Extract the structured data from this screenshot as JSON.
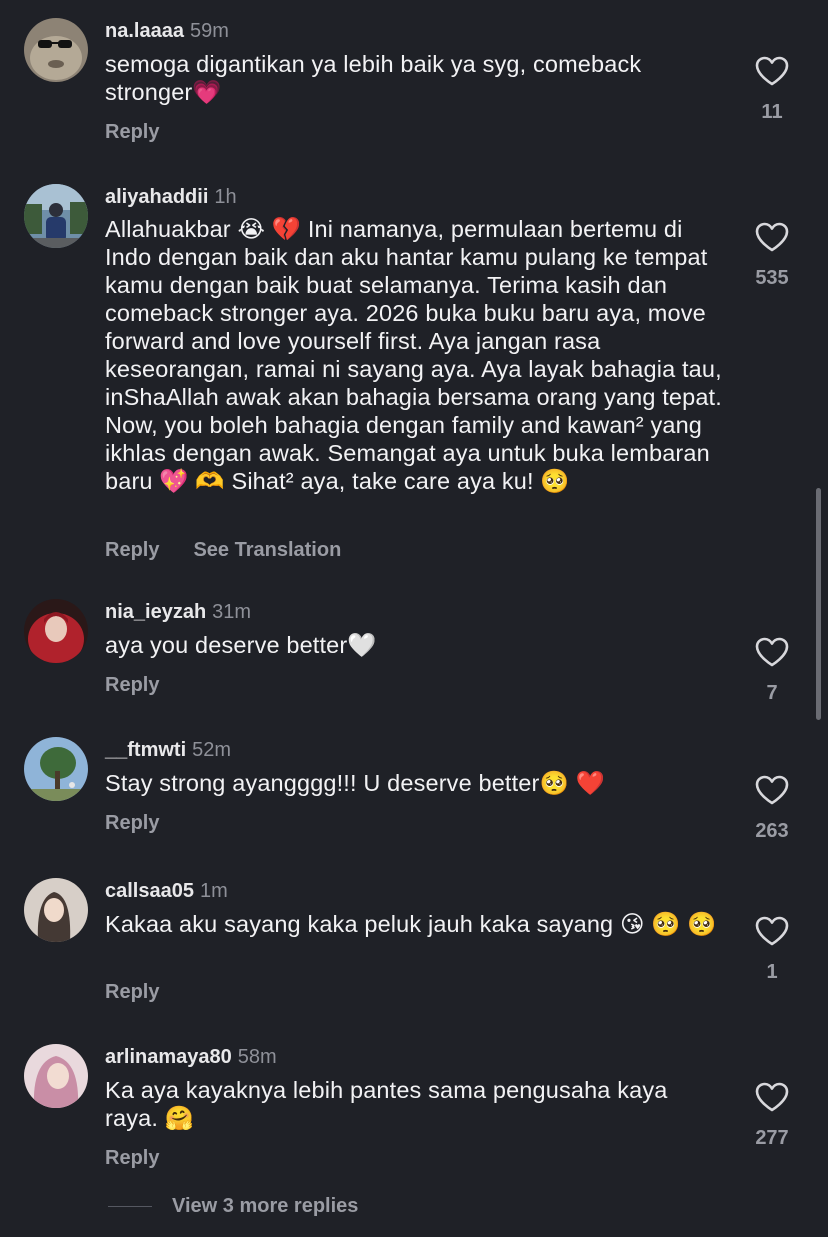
{
  "comments": [
    {
      "username": "na.laaaa",
      "time": "59m",
      "text": "semoga digantikan ya lebih baik ya syg, comeback stronger💗",
      "reply_label": "Reply",
      "likes": "11"
    },
    {
      "username": "aliyahaddii",
      "time": "1h",
      "text": "Allahuakbar 😭 💔  Ini namanya, permulaan bertemu di Indo dengan baik dan aku hantar kamu pulang ke tempat kamu dengan baik buat selamanya. Terima kasih dan comeback stronger aya. 2026 buka buku baru aya, move forward and love yourself first. Aya jangan rasa keseorangan, ramai ni sayang aya. Aya layak bahagia tau, inShaAllah awak akan bahagia bersama orang yang tepat. Now, you boleh bahagia dengan family and kawan² yang ikhlas dengan awak. Semangat aya untuk buka lembaran baru 💖 🫶 Sihat² aya, take care aya ku! 🥺",
      "reply_label": "Reply",
      "see_translation_label": "See Translation",
      "likes": "535"
    },
    {
      "username": "nia_ieyzah",
      "time": "31m",
      "text": "aya you deserve better🤍",
      "reply_label": "Reply",
      "likes": "7"
    },
    {
      "username": "__ftmwti",
      "time": "52m",
      "text": "Stay strong ayangggg!!! U deserve better🥺 ❤️",
      "reply_label": "Reply",
      "likes": "263"
    },
    {
      "username": "callsaa05",
      "time": "1m",
      "text": "Kakaa aku sayang kaka peluk jauh kaka sayang 😘 🥺 🥺",
      "reply_label": "Reply",
      "likes": "1"
    },
    {
      "username": "arlinamaya80",
      "time": "58m",
      "text": "Ka aya kayaknya lebih pantes sama pengusaha kaya raya. 🤗",
      "reply_label": "Reply",
      "likes": "277"
    }
  ],
  "view_more_replies": "View 3 more replies",
  "icons": {
    "like": "heart-outline-icon"
  },
  "colors": {
    "background": "#1f2127",
    "text": "#f2f2f4",
    "secondary_text": "#9a9ca4"
  }
}
